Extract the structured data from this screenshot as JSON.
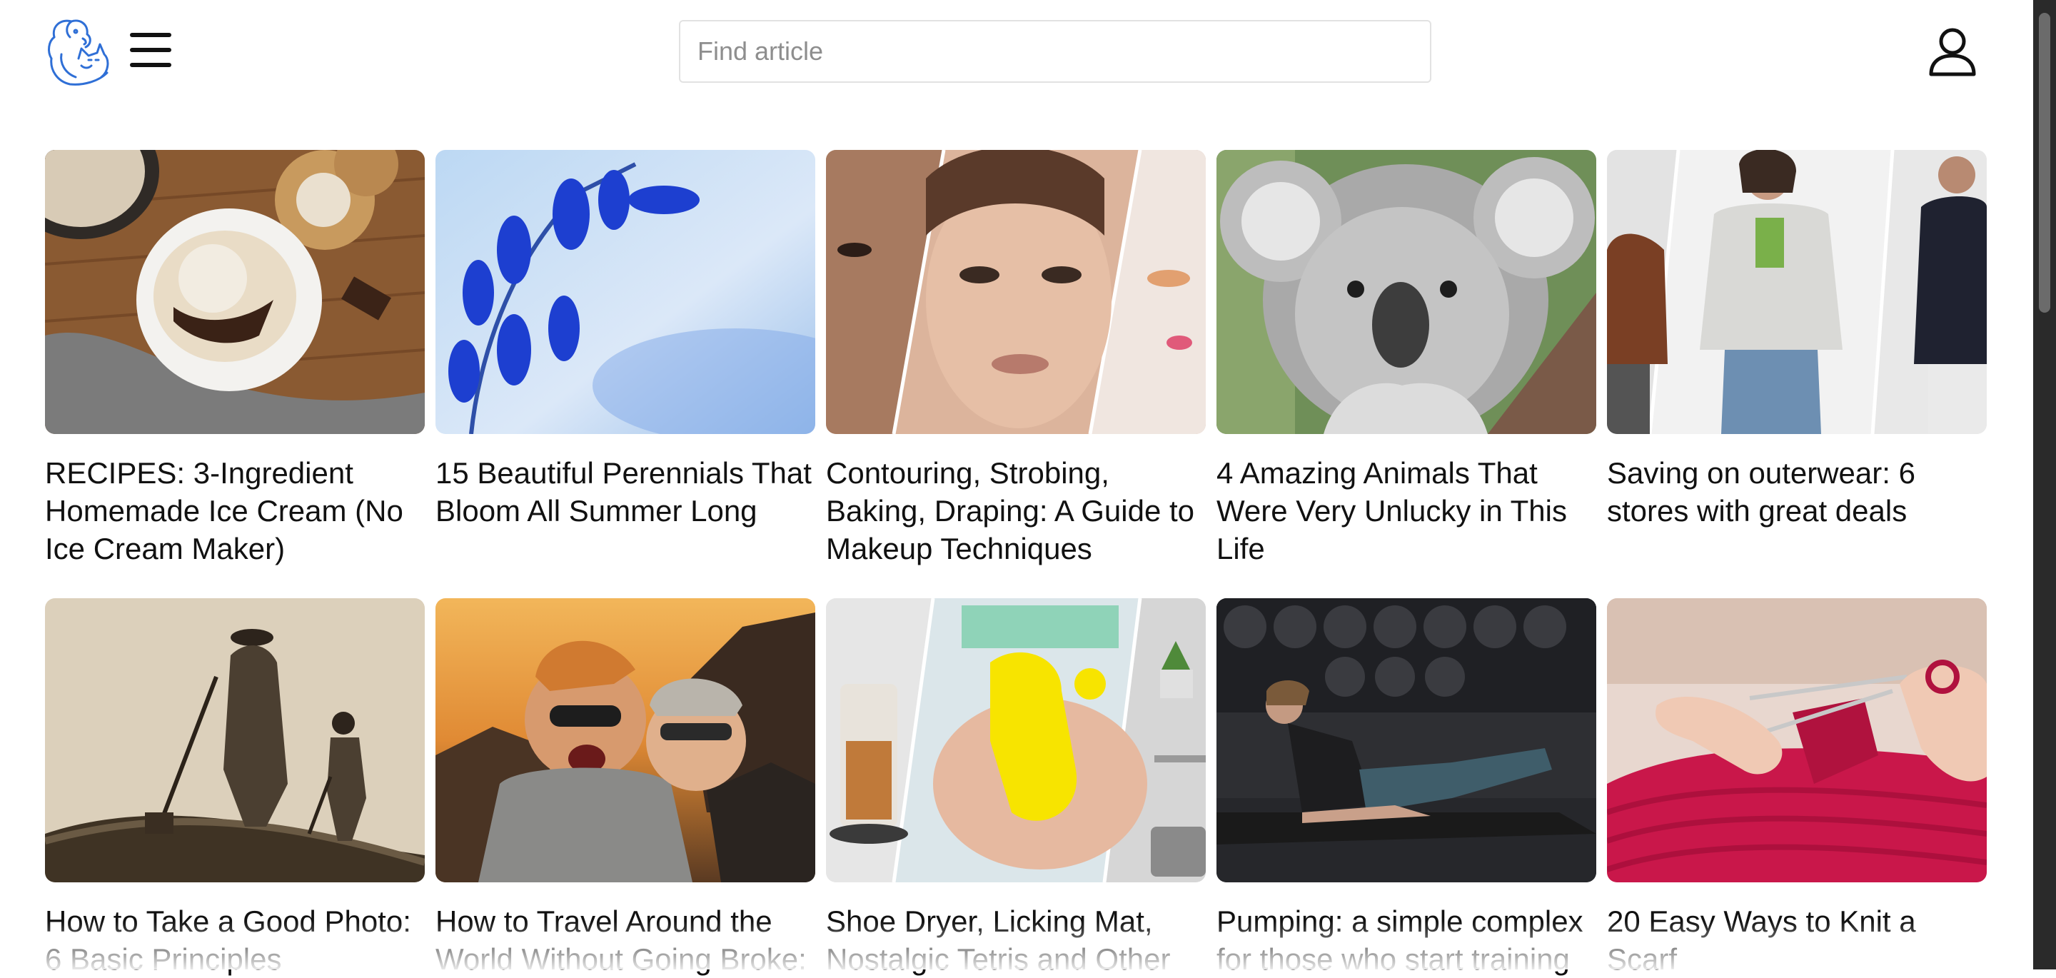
{
  "header": {
    "logo_icon": "dog-and-cat-logo",
    "menu_icon": "hamburger-menu-icon",
    "search": {
      "placeholder": "Find article",
      "value": ""
    },
    "user_icon": "user-profile-icon"
  },
  "articles": [
    {
      "title": "RECIPES: 3-Ingredient Homemade Ice Cream (No Ice Cream Maker)",
      "image": "ice-cream-bowl-image"
    },
    {
      "title": "15 Beautiful Perennials That Bloom All Summer Long",
      "image": "bluebell-flowers-image"
    },
    {
      "title": "Contouring, Strobing, Baking, Draping: A Guide to Makeup Techniques",
      "image": "makeup-faces-collage-image"
    },
    {
      "title": "4 Amazing Animals That Were Very Unlucky in This Life",
      "image": "koala-image"
    },
    {
      "title": "Saving on outerwear: 6 stores with great deals",
      "image": "outerwear-models-image"
    },
    {
      "title": "How to Take a Good Photo: 6 Basic Principles",
      "image": "vintage-photo-figures-image"
    },
    {
      "title": "How to Travel Around the World Without Going Broke:",
      "image": "travel-selfie-couple-image"
    },
    {
      "title": "Shoe Dryer, Licking Mat, Nostalgic Tetris and Other",
      "image": "gadgets-collage-image"
    },
    {
      "title": "Pumping: a simple complex for those who start training",
      "image": "gym-workout-image"
    },
    {
      "title": "20 Easy Ways to Knit a Scarf",
      "image": "knitting-scarf-image"
    }
  ],
  "colors": {
    "logo_blue": "#2f6fd6",
    "text": "#111111",
    "search_border": "#e2e2e2",
    "placeholder": "#8e8e8e"
  }
}
